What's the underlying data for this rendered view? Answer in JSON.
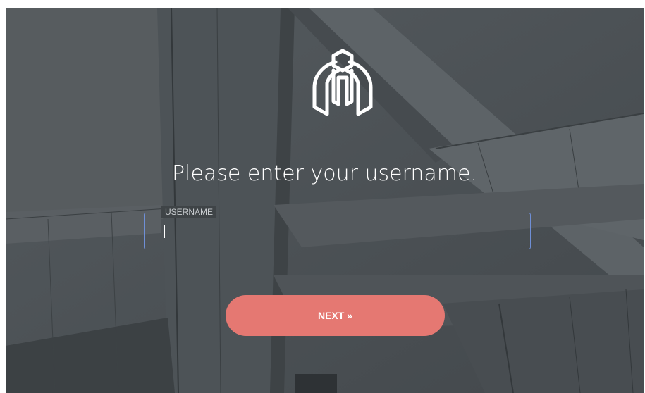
{
  "prompt": "Please enter your username.",
  "username_field": {
    "label": "USERNAME",
    "value": ""
  },
  "next_button": {
    "label": "NEXT »"
  },
  "colors": {
    "button": "#e57872",
    "field_border": "#6f8fd6",
    "overlay": "#4a4f53"
  },
  "icons": [
    "building-logo-icon"
  ]
}
